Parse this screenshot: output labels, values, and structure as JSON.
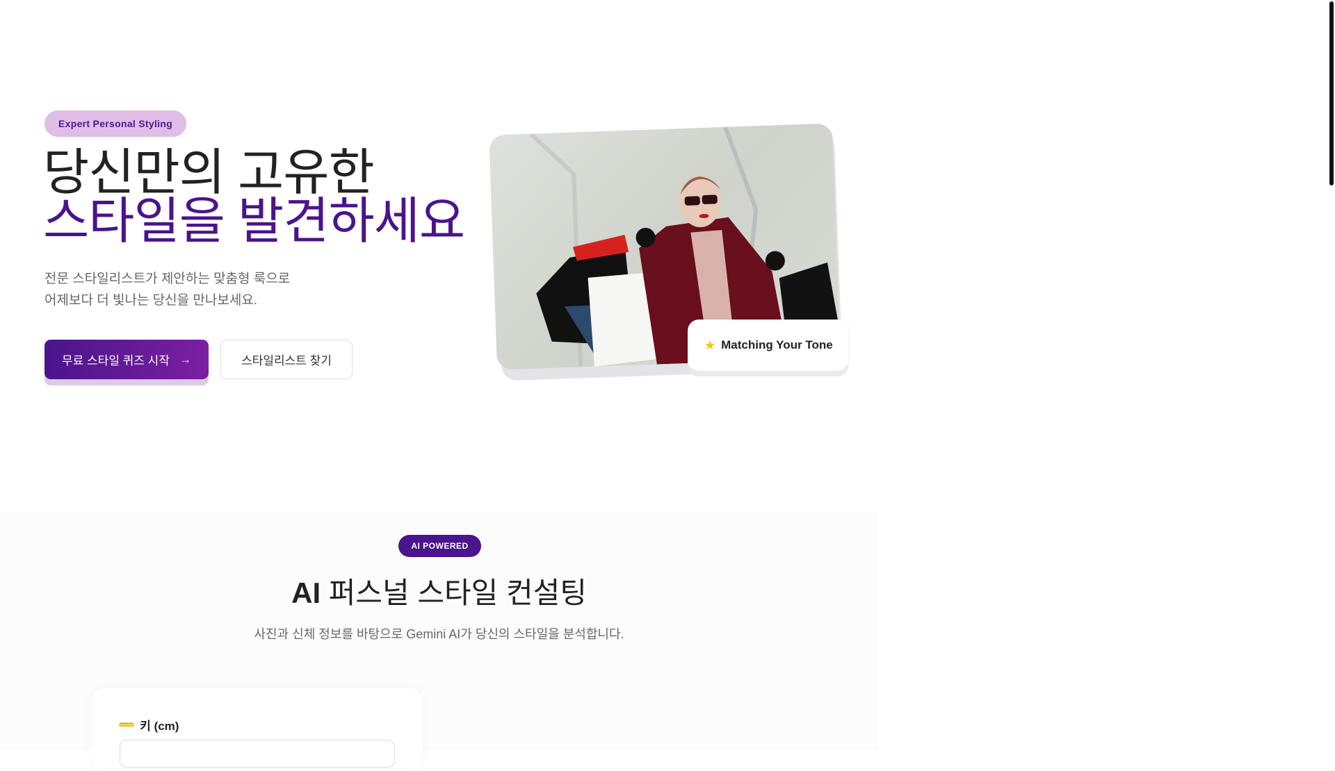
{
  "hero": {
    "badge": "Expert Personal Styling",
    "title_line1": "당신만의 고유한",
    "title_line2": "스타일을 발견하세요",
    "description_line1": "전문 스타일리스트가 제안하는 맞춤형 룩으로",
    "description_line2": "어제보다 더 빛나는 당신을 만나보세요.",
    "primary_button": "무료 스타일 퀴즈 시작",
    "secondary_button": "스타일리스트 찾기",
    "image_tag": "Matching Your Tone"
  },
  "ai_section": {
    "badge": "AI POWERED",
    "title_bold": "AI",
    "title_rest": " 퍼스널 스타일 컨설팅",
    "subtitle": "사진과 신체 정보를 바탕으로 Gemini AI가 당신의 스타일을 분석합니다.",
    "height_label": "키 (cm)"
  },
  "colors": {
    "accent": "#4a148c",
    "accent2": "#7b1fa2",
    "badge_bg": "#dfbde6",
    "star": "#f5c518"
  }
}
